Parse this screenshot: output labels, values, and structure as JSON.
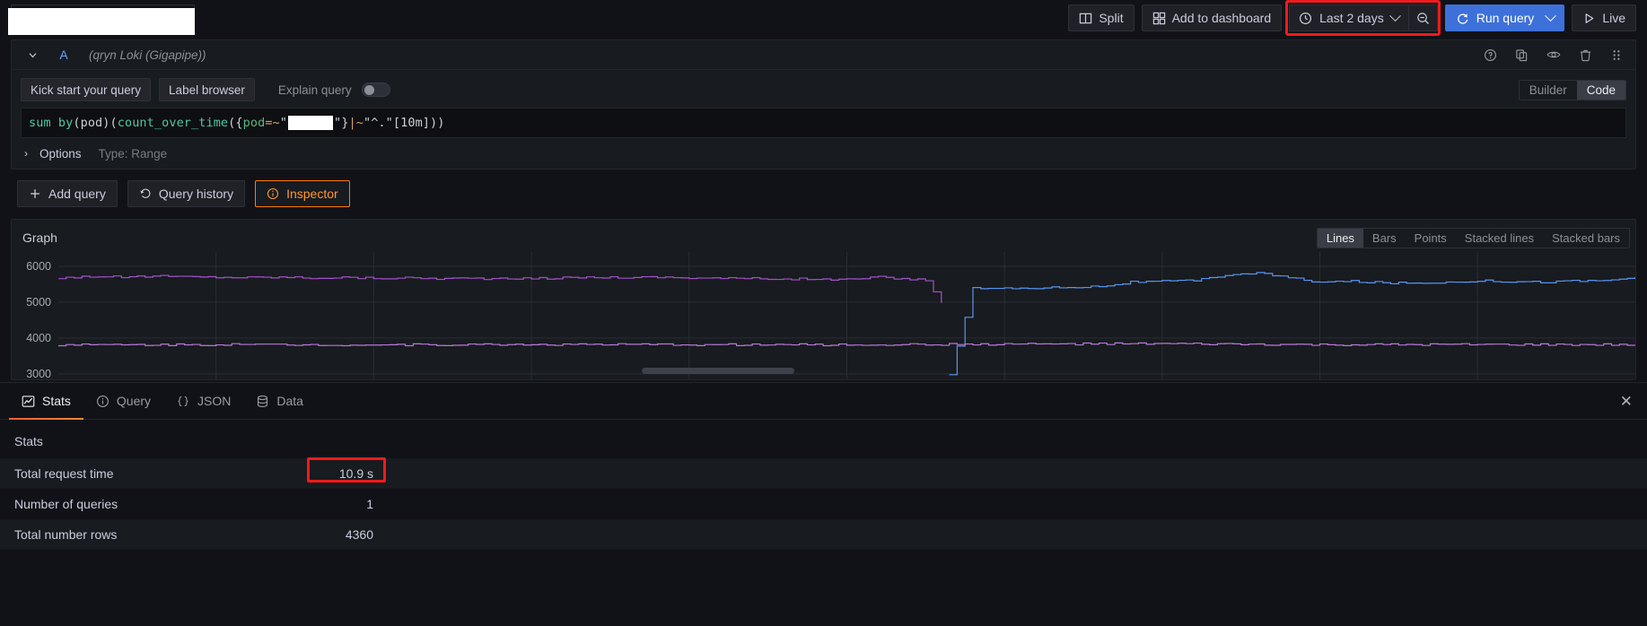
{
  "toolbar": {
    "datasource_value": "",
    "split_label": "Split",
    "add_to_dashboard_label": "Add to dashboard",
    "time_range_label": "Last 2 days",
    "run_query_label": "Run query",
    "live_label": "Live",
    "icons": {
      "split": "split-panes-icon",
      "dashboard": "grid-icon",
      "clock": "clock-icon",
      "zoom_out": "search-minus-icon",
      "refresh": "refresh-icon",
      "play": "play-icon"
    }
  },
  "query_row": {
    "ref_id": "A",
    "datasource_name": "(qryn Loki (Gigapipe))",
    "actions": {
      "help": "help-circle-icon",
      "duplicate": "copy-icon",
      "disable": "eye-icon",
      "remove": "trash-icon",
      "drag": "drag-handle-icon"
    }
  },
  "editor": {
    "kick_start_label": "Kick start your query",
    "label_browser_label": "Label browser",
    "explain_query_label": "Explain query",
    "explain_query_on": false,
    "mode_builder_label": "Builder",
    "mode_code_label": "Code",
    "mode_selected": "Code",
    "query_tokens": {
      "t1": "sum by ",
      "t2": "(pod)(",
      "t3": "count_over_time",
      "t4": "({",
      "t5": "pod",
      "t6": "=~",
      "t7": "\"",
      "t8": "\"} ",
      "t9": "|~ ",
      "t10": "\"^.\"",
      "t11": "[10m]))"
    },
    "options_label": "Options",
    "options_meta": "Type: Range"
  },
  "actions": {
    "add_query_label": "Add query",
    "query_history_label": "Query history",
    "inspector_label": "Inspector",
    "inspector_active": true
  },
  "graph": {
    "title": "Graph",
    "viz_options": [
      "Lines",
      "Bars",
      "Points",
      "Stacked lines",
      "Stacked bars"
    ],
    "viz_selected": "Lines"
  },
  "chart_data": {
    "type": "line",
    "title": "Graph",
    "xlabel": "",
    "ylabel": "",
    "ytick_labels": [
      "6000",
      "5000",
      "4000",
      "3000"
    ],
    "ytick_values": [
      6000,
      5000,
      4000,
      3000
    ],
    "ylim": [
      2800,
      6400
    ],
    "grid": true,
    "legend": "none",
    "series": [
      {
        "name": "series-purple-high",
        "color": "#a352cc",
        "x": [
          0,
          0.02,
          0.04,
          0.06,
          0.08,
          0.1,
          0.12,
          0.14,
          0.16,
          0.18,
          0.2,
          0.22,
          0.24,
          0.26,
          0.28,
          0.3,
          0.32,
          0.34,
          0.36,
          0.38,
          0.4,
          0.42,
          0.44,
          0.46,
          0.48,
          0.5,
          0.52,
          0.54,
          0.55,
          0.56
        ],
        "values": [
          5680,
          5720,
          5700,
          5730,
          5710,
          5700,
          5690,
          5700,
          5680,
          5690,
          5670,
          5680,
          5660,
          5670,
          5650,
          5660,
          5680,
          5700,
          5690,
          5700,
          5680,
          5670,
          5660,
          5650,
          5640,
          5630,
          5700,
          5640,
          5620,
          4980
        ]
      },
      {
        "name": "series-blue-high",
        "color": "#5794f2",
        "x": [
          0.565,
          0.58,
          0.6,
          0.62,
          0.64,
          0.66,
          0.68,
          0.7,
          0.72,
          0.74,
          0.76,
          0.78,
          0.8,
          0.82,
          0.84,
          0.86,
          0.88,
          0.9,
          0.92,
          0.94,
          0.96,
          0.98,
          1.0
        ],
        "values": [
          3000,
          5390,
          5380,
          5400,
          5420,
          5440,
          5560,
          5580,
          5600,
          5760,
          5820,
          5680,
          5560,
          5580,
          5540,
          5530,
          5560,
          5600,
          5580,
          5560,
          5590,
          5600,
          5700
        ]
      },
      {
        "name": "series-purple-low",
        "color": "#b877d9",
        "x": [
          0,
          0.1,
          0.2,
          0.3,
          0.4,
          0.5,
          0.6,
          0.7,
          0.8,
          0.9,
          1.0
        ],
        "values": [
          3810,
          3815,
          3810,
          3820,
          3815,
          3810,
          3830,
          3840,
          3810,
          3815,
          3810
        ]
      }
    ]
  },
  "inspector": {
    "tabs": [
      {
        "label": "Stats",
        "icon": "chart-line-icon",
        "active": true
      },
      {
        "label": "Query",
        "icon": "info-circle-icon",
        "active": false
      },
      {
        "label": "JSON",
        "icon": "braces-icon",
        "active": false
      },
      {
        "label": "Data",
        "icon": "database-icon",
        "active": false
      }
    ],
    "close_icon": "close-icon",
    "heading": "Stats",
    "rows": [
      {
        "name": "Total request time",
        "value": "10.9 s",
        "highlighted": true
      },
      {
        "name": "Number of queries",
        "value": "1",
        "highlighted": false
      },
      {
        "name": "Total number rows",
        "value": "4360",
        "highlighted": false
      }
    ]
  }
}
